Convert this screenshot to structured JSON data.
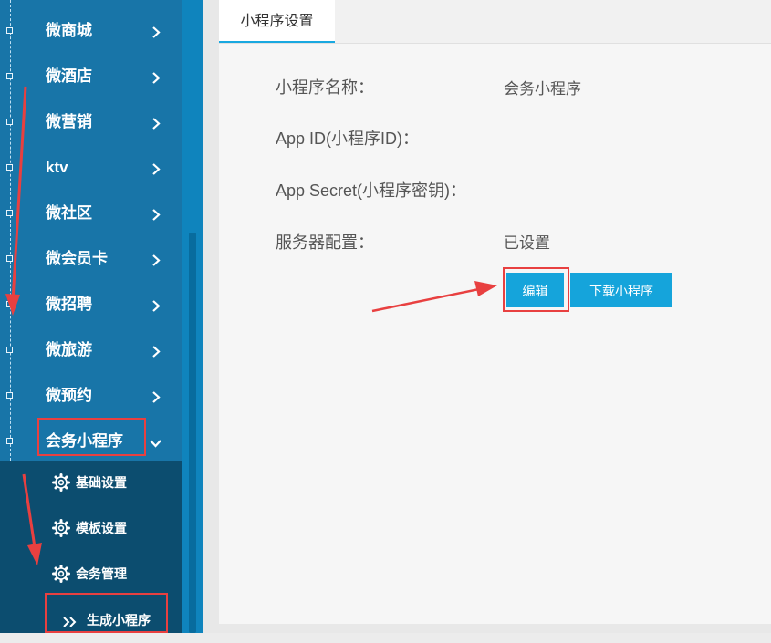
{
  "sidebar": {
    "items": [
      {
        "label": "微商城"
      },
      {
        "label": "微酒店"
      },
      {
        "label": "微营销"
      },
      {
        "label": "ktv"
      },
      {
        "label": "微社区"
      },
      {
        "label": "微会员卡"
      },
      {
        "label": "微招聘"
      },
      {
        "label": "微旅游"
      },
      {
        "label": "微预约"
      },
      {
        "label": "会务小程序"
      }
    ],
    "sub_items": [
      {
        "label": "基础设置"
      },
      {
        "label": "模板设置"
      },
      {
        "label": "会务管理"
      },
      {
        "label": "生成小程序"
      }
    ]
  },
  "main": {
    "tab_label": "小程序设置",
    "rows": [
      {
        "label": "小程序名称：",
        "value": "会务小程序"
      },
      {
        "label": "App ID(小程序ID)：",
        "value": ""
      },
      {
        "label": "App Secret(小程序密钥)：",
        "value": ""
      },
      {
        "label": "服务器配置：",
        "value": "已设置"
      }
    ],
    "edit_button": "编辑",
    "download_button": "下载小程序"
  },
  "colors": {
    "sidebar_bg": "#1875a8",
    "submenu_bg": "#0c4d6f",
    "accent": "#15a4db",
    "annotation_red": "#e84040"
  }
}
